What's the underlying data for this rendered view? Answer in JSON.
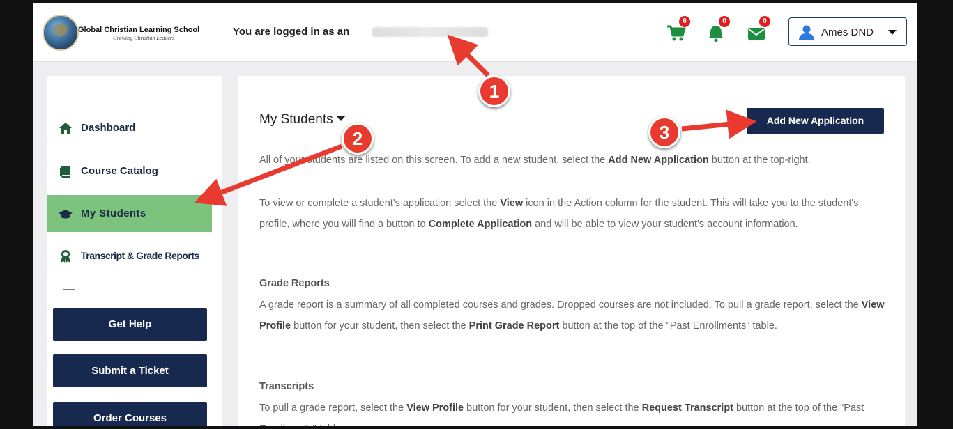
{
  "header": {
    "school_name": "Global Christian Learning School",
    "school_tagline": "Growing Christian Leaders",
    "login_text": "You are logged in as an",
    "cart_count": "6",
    "notifications_count": "0",
    "messages_count": "0",
    "user_name": "Ames DND"
  },
  "sidebar": {
    "items": [
      {
        "label": "Dashboard",
        "icon": "home-icon"
      },
      {
        "label": "Course Catalog",
        "icon": "book-icon"
      },
      {
        "label": "My Students",
        "icon": "graduation-cap-icon"
      },
      {
        "label": "Transcript & Grade Reports",
        "icon": "award-icon"
      }
    ],
    "active": "My Students",
    "buttons": [
      "Get Help",
      "Submit a Ticket",
      "Order Courses"
    ]
  },
  "main": {
    "title": "My Students",
    "add_button": "Add New Application",
    "intro": {
      "before": "All of your students are listed on this screen. To add a new student, select the ",
      "bold": "Add New Application",
      "after": " button at the top-right."
    },
    "view_para": {
      "t1": "To view or complete a student's application select the ",
      "b1": "View",
      "t2": " icon in the Action column for the student. This will take you to the student's profile, where you will find a button to ",
      "b2": "Complete Application",
      "t3": " and will be able to view your student's account information."
    },
    "grade_heading": "Grade Reports",
    "grade_para": {
      "t1": "A grade report is a summary of all completed courses and grades. Dropped courses are not included. To pull a grade report, select the ",
      "b1": "View Profile",
      "t2": " button for your student, then select the ",
      "b2": "Print Grade Report",
      "t3": " button at the top of the \"Past Enrollments\" table."
    },
    "transcripts_heading": "Transcripts",
    "transcripts_para": {
      "t1": "To pull a grade report, select the ",
      "b1": "View Profile",
      "t2": " button for your student, then select the ",
      "b2": "Request Transcript",
      "t3": " button at the top of the \"Past Enrollments\" table."
    }
  },
  "annotations": [
    "1",
    "2",
    "3"
  ],
  "colors": {
    "navy": "#17294f",
    "active_green": "#7cc47e",
    "badge_red": "#e21b1b",
    "annotation_red": "#e83a2e"
  }
}
